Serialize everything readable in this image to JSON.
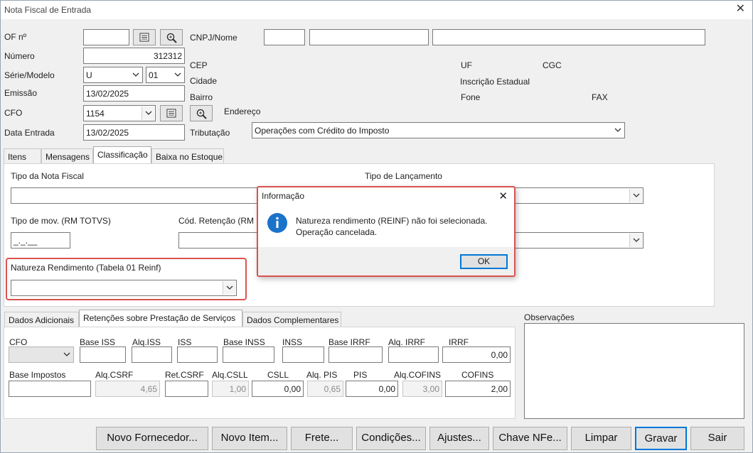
{
  "window": {
    "title": "Nota Fiscal de Entrada",
    "close": "✕"
  },
  "header": {
    "of_label": "OF nº",
    "numero_label": "Número",
    "numero_value": "312312",
    "serie_label": "Série/Modelo",
    "serie_value": "U",
    "modelo_value": "01",
    "emissao_label": "Emissão",
    "emissao_value": "13/02/2025",
    "cfo_label": "CFO",
    "cfo_value": "1154",
    "data_entrada_label": "Data Entrada",
    "data_entrada_value": "13/02/2025",
    "cnpj_label": "CNPJ/Nome",
    "cep_label": "CEP",
    "cidade_label": "Cidade",
    "bairro_label": "Bairro",
    "endereco_label": "Endereço",
    "tributacao_label": "Tributação",
    "tributacao_value": "Operações com Crédito do Imposto",
    "uf_label": "UF",
    "cgc_label": "CGC",
    "inscricao_label": "Inscrição Estadual",
    "fone_label": "Fone",
    "fax_label": "FAX"
  },
  "tabs": [
    "Itens",
    "Mensagens",
    "Classificação",
    "Baixa no Estoque"
  ],
  "classificacao": {
    "tipo_nota_label": "Tipo da Nota Fiscal",
    "tipo_lancamento_label": "Tipo de Lançamento",
    "tipo_mov_label": "Tipo de mov. (RM TOTVS)",
    "tipo_mov_value": "_._.__",
    "cod_retencao_label": "Cód. Retenção (RM",
    "natureza_label": "Natureza Rendimento (Tabela 01 Reinf)"
  },
  "lower_tabs": [
    "Dados Adicionais",
    "Retenções sobre Prestação de Serviços",
    "Dados Complementares"
  ],
  "retencoes": {
    "row1_labels": [
      "CFO",
      "Base ISS",
      "Alq.ISS",
      "ISS",
      "Base INSS",
      "INSS",
      "Base IRRF",
      "Alq. IRRF",
      "IRRF"
    ],
    "irrf_value": "0,00",
    "row2_labels": [
      "Base Impostos",
      "Alq.CSRF",
      "Ret.CSRF",
      "Alq.CSLL",
      "CSLL",
      "Alq. PIS",
      "PIS",
      "Alq.COFINS",
      "COFINS"
    ],
    "alq_csrf": "4,65",
    "alq_csll": "1,00",
    "csll": "0,00",
    "alq_pis": "0,65",
    "pis": "0,00",
    "alq_cofins": "3,00",
    "cofins": "2,00"
  },
  "observacoes_label": "Observações",
  "buttons": {
    "novo_fornecedor": "Novo Fornecedor...",
    "novo_item": "Novo Item...",
    "frete": "Frete...",
    "condicoes": "Condições...",
    "ajustes": "Ajustes...",
    "chave_nfe": "Chave NFe...",
    "limpar": "Limpar",
    "gravar": "Gravar",
    "sair": "Sair"
  },
  "dialog": {
    "title": "Informação",
    "line1": "Natureza rendimento (REINF) não foi selecionada.",
    "line2": "Operação cancelada.",
    "ok": "OK",
    "close": "✕"
  },
  "colors": {
    "highlight": "#d9534f",
    "focus": "#0078d7",
    "info_icon": "#1a73c8"
  }
}
